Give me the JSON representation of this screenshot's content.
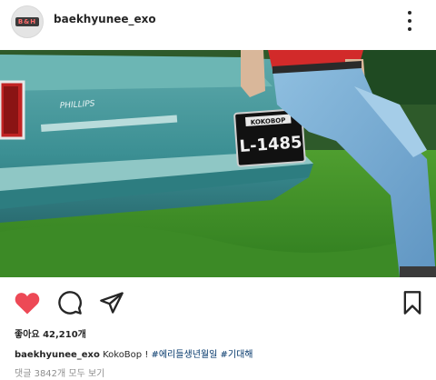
{
  "post": {
    "username": "baekhyunee_exo",
    "avatar_text": "B&H"
  },
  "photo": {
    "plate_top": "KOKOBOP",
    "plate_main": "L-1485",
    "car_badge": "PHILLIPS"
  },
  "icons": {
    "more": "more-vertical-icon",
    "like": "heart-filled-icon",
    "comment": "comment-bubble-icon",
    "share": "paper-plane-icon",
    "save": "bookmark-icon"
  },
  "likes": {
    "label": "좋아요",
    "count": "42,210개"
  },
  "caption": {
    "username": "baekhyunee_exo",
    "text": "KokoBop !",
    "hashtag1": "#에리들생년월일",
    "hashtag2": "#기대해"
  },
  "comments": {
    "view_all": "댓글 3842개 모두 보기"
  },
  "colors": {
    "like_red": "#ed4956",
    "hashtag_blue": "#003569",
    "muted_gray": "#8e8e8e"
  }
}
